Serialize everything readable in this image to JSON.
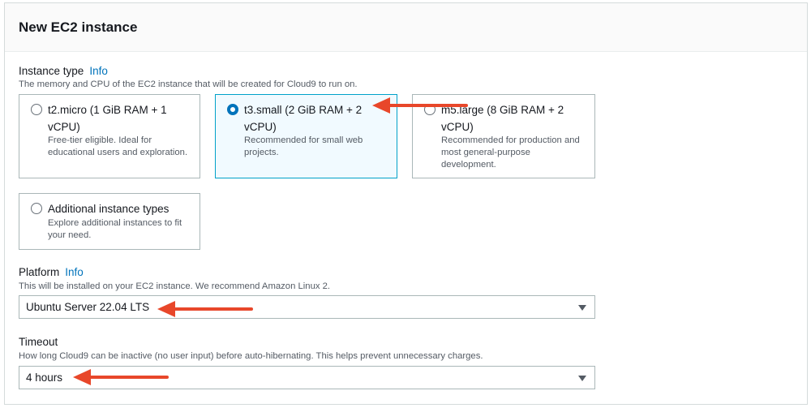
{
  "panel": {
    "title": "New EC2 instance"
  },
  "instance_type": {
    "label": "Instance type",
    "info": "Info",
    "description": "The memory and CPU of the EC2 instance that will be created for Cloud9 to run on.",
    "options": [
      {
        "title": "t2.micro (1 GiB RAM + 1 vCPU)",
        "description": "Free-tier eligible. Ideal for educational users and exploration.",
        "selected": false
      },
      {
        "title": "t3.small (2 GiB RAM + 2 vCPU)",
        "description": "Recommended for small web projects.",
        "selected": true
      },
      {
        "title": "m5.large (8 GiB RAM + 2 vCPU)",
        "description": "Recommended for production and most general-purpose development.",
        "selected": false
      },
      {
        "title": "Additional instance types",
        "description": "Explore additional instances to fit your need.",
        "selected": false
      }
    ]
  },
  "platform": {
    "label": "Platform",
    "info": "Info",
    "description": "This will be installed on your EC2 instance. We recommend Amazon Linux 2.",
    "value": "Ubuntu Server 22.04 LTS"
  },
  "timeout": {
    "label": "Timeout",
    "description": "How long Cloud9 can be inactive (no user input) before auto-hibernating. This helps prevent unnecessary charges.",
    "value": "4 hours"
  },
  "colors": {
    "accent": "#0073bb",
    "selected_bg": "#f1faff",
    "annotation_arrow": "#e8472a"
  }
}
